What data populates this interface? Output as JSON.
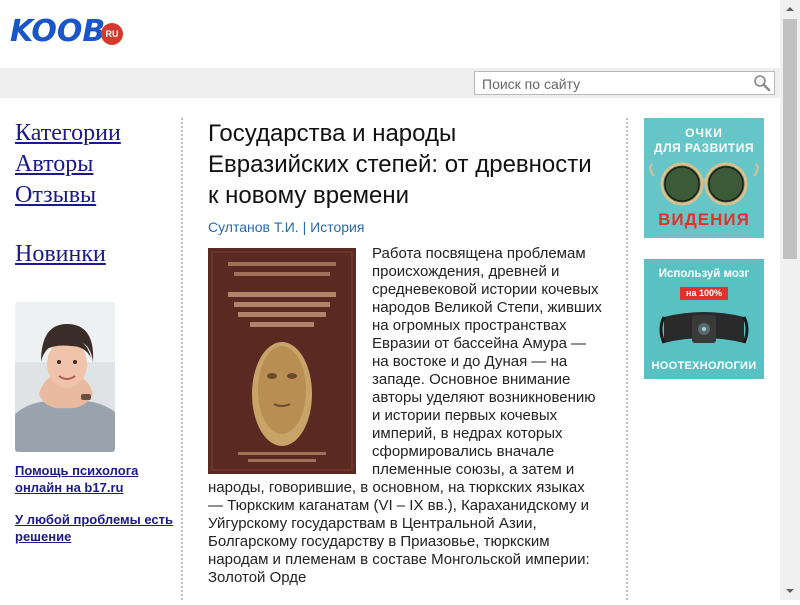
{
  "header": {
    "logo_text": "KOOB",
    "logo_badge": "RU",
    "search_placeholder": "Поиск по сайту"
  },
  "nav": {
    "items": [
      "Категории",
      "Авторы",
      "Отзывы"
    ],
    "new_label": "Новинки"
  },
  "promo": {
    "link1": "Помощь психолога онлайн на b17.ru",
    "link2": "У любой проблемы есть решение"
  },
  "book": {
    "title": "Государства и народы Евразийских степей: от древности к новому времени",
    "author": "Султанов Т.И.",
    "separator": "|",
    "category": "История",
    "description": "Работа посвящена проблемам происхождения, древней и средневековой истории кочевых народов Великой Степи, живших на огромных пространствах Евразии от бассейна Амура — на востоке и до Дуная — на западе. Основное внимание авторы уделяют возникновению и истории первых кочевых империй, в недрах которых сформировались вначале племенные союзы, а затем и народы, говорившие, в основном, на тюркских языках — Тюркским каганатам (VI – IX вв.), Караханидскому и Уйгурскому государствам в Центральной Азии, Болгарскому государству в Приазовье, тюркским народам и племенам в составе Монгольской империи: Золотой Орде"
  },
  "ads": {
    "ad1_line1": "ОЧКИ",
    "ad1_line2": "ДЛЯ РАЗВИТИЯ",
    "ad1_line3": "ВИДЕНИЯ",
    "ad2_line1": "Используй мозг",
    "ad2_badge": "на 100%",
    "ad2_line3": "НООТЕХНОЛОГИИ"
  },
  "colors": {
    "logo": "#1a56c8",
    "link": "#1a1a8c",
    "meta": "#2a6aa8",
    "ad_bg": "#66c6c7",
    "ad_red": "#e0322a"
  }
}
